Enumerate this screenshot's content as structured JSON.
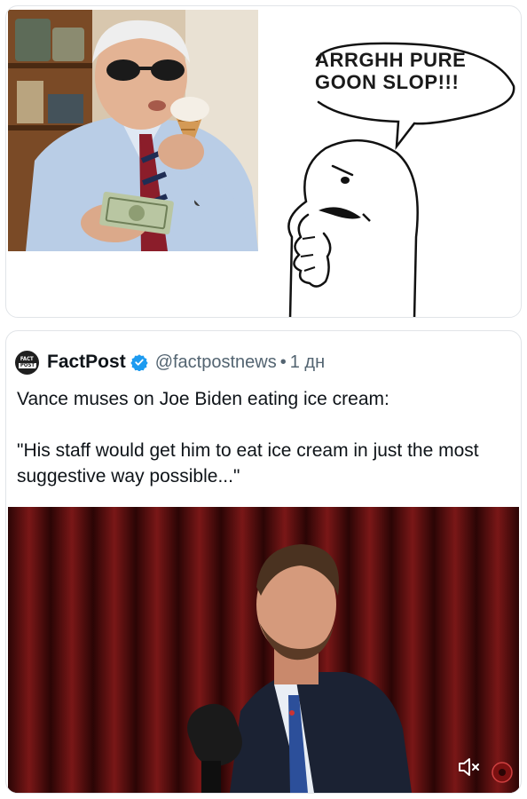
{
  "meme": {
    "speech_bubble_text": "ARRGHH PURE GOON SLOP!!!",
    "photo_icon": "person-eating-ice-cream-photo",
    "drawing_icon": "angry-wojak-drawing"
  },
  "post": {
    "author": {
      "name": "FactPost",
      "handle": "@factpostnews",
      "avatar_text_top": "FACT",
      "avatar_text_bottom": "POST",
      "verified_icon": "verified-badge-icon"
    },
    "separator": "•",
    "time": "1 дн",
    "text_lines": [
      "Vance muses on Joe Biden eating ice cream:",
      "\"His staff would get him to eat ice cream in just the most suggestive way possible...\""
    ],
    "media": {
      "video_icon": "podcast-video-frame",
      "mute_icon": "speaker-muted-icon",
      "watermark_icon": "channel-watermark-icon"
    }
  },
  "colors": {
    "text_primary": "#0f1419",
    "text_secondary": "#536471",
    "verified_blue": "#1d9bf0",
    "border": "#e1e4e8",
    "curtain_red": "#6b1414"
  }
}
